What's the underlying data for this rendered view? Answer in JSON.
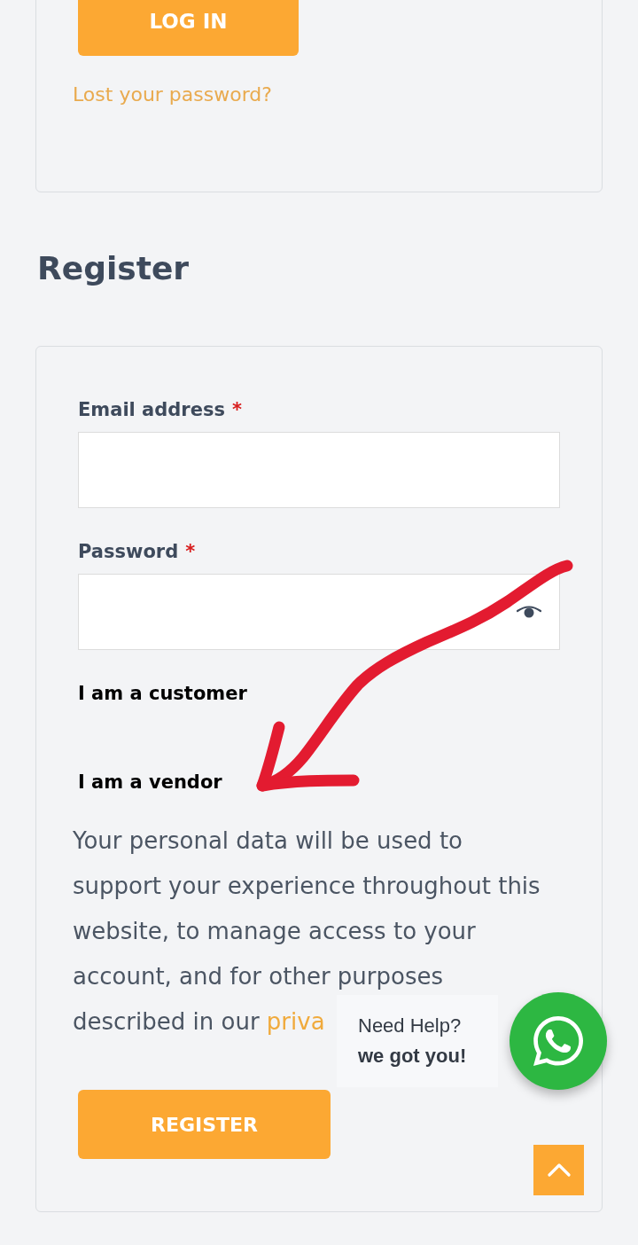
{
  "login": {
    "button": "LOG IN",
    "lost_password_link": "Lost your password?"
  },
  "register": {
    "heading": "Register",
    "fields": [
      {
        "label": "Email address",
        "required_mark": "*",
        "kind": "text"
      },
      {
        "label": "Password",
        "required_mark": "*",
        "kind": "password"
      }
    ],
    "roles": [
      "I am a customer",
      "I am a vendor"
    ],
    "privacy_text": "Your personal data will be used to support your experience throughout this website, to manage access to your account, and for other purposes",
    "privacy_text_end": "described in our",
    "privacy_link": "priva",
    "button": "REGISTER"
  },
  "help_bubble": {
    "line_1": "Need Help?",
    "line_2": "we got you!"
  }
}
